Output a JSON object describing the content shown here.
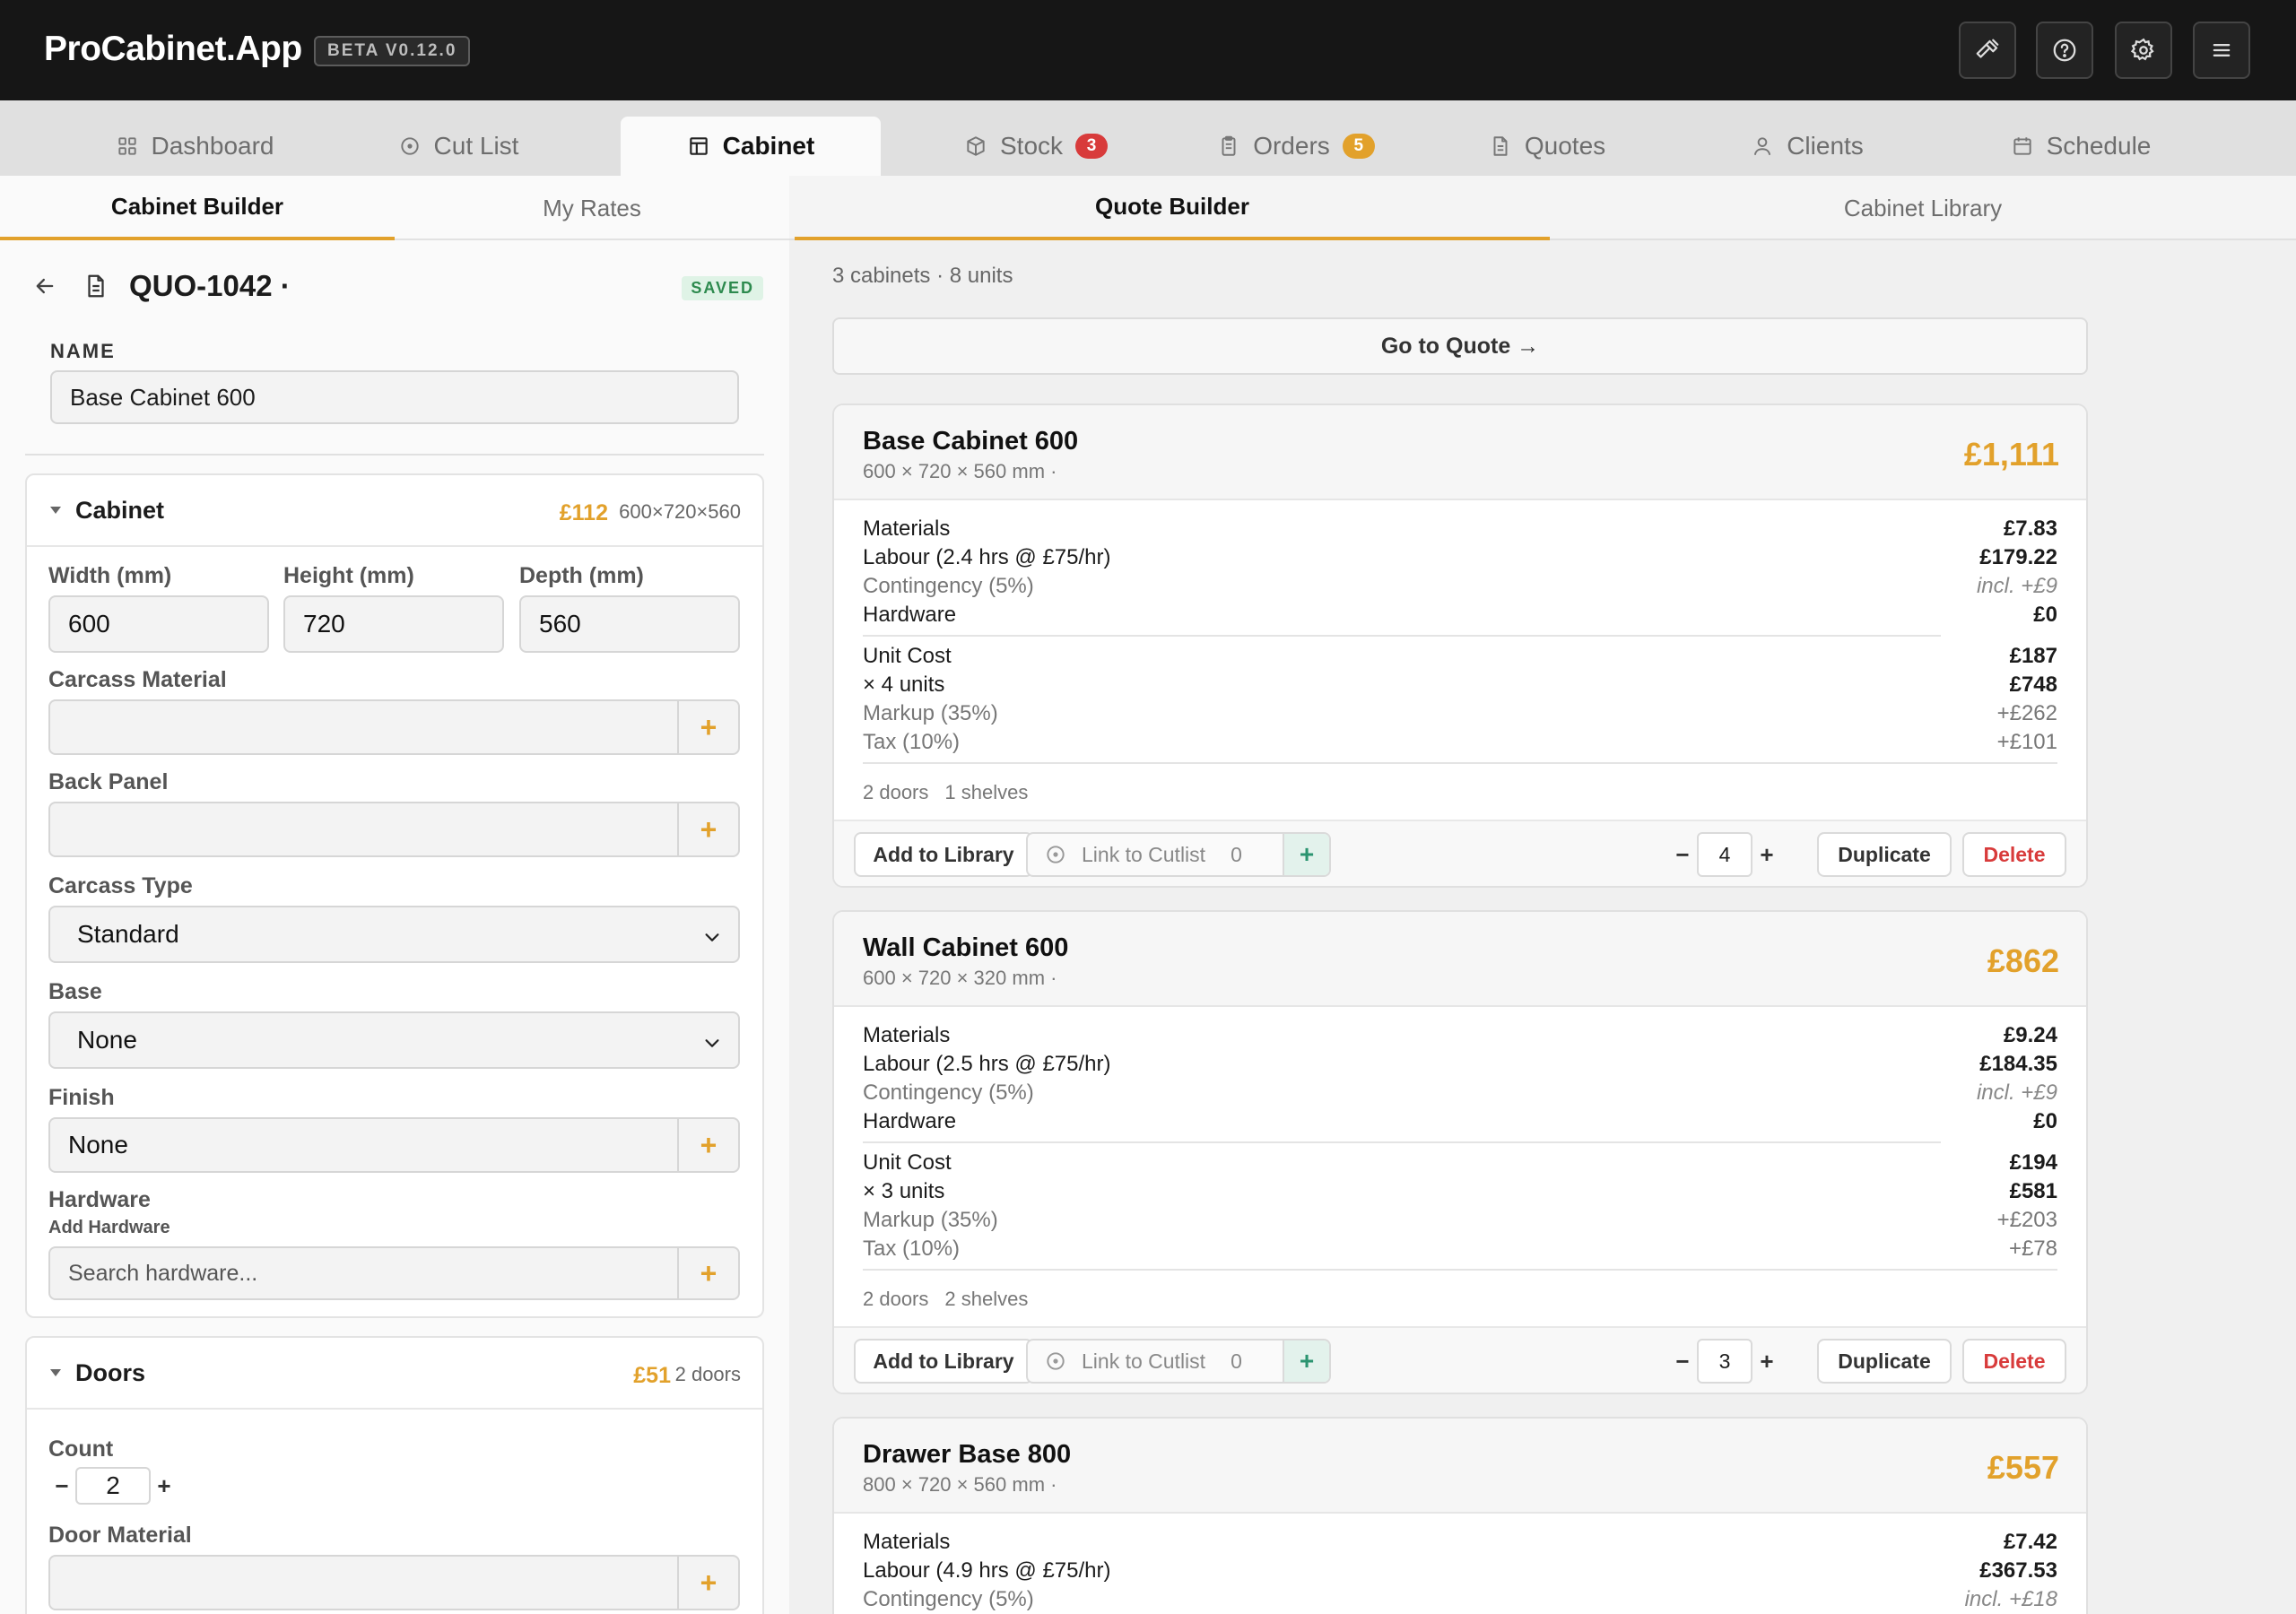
{
  "app": {
    "brand": "ProCabinet.App",
    "version": "BETA V0.12.0"
  },
  "toolbar_icons": [
    "hammer-icon",
    "help-icon",
    "settings-icon",
    "menu-icon"
  ],
  "main_tabs": [
    {
      "label": "Dashboard",
      "icon": "dashboard-icon"
    },
    {
      "label": "Cut List",
      "icon": "target-icon"
    },
    {
      "label": "Cabinet",
      "icon": "cabinet-icon",
      "active": true
    },
    {
      "label": "Stock",
      "icon": "box-icon",
      "badge": "3"
    },
    {
      "label": "Orders",
      "icon": "clipboard-icon",
      "badge": "5"
    },
    {
      "label": "Quotes",
      "icon": "document-icon"
    },
    {
      "label": "Clients",
      "icon": "user-icon"
    },
    {
      "label": "Schedule",
      "icon": "calendar-icon"
    }
  ],
  "left_tabs": {
    "builder": "Cabinet Builder",
    "rates": "My Rates"
  },
  "quote": {
    "number": "QUO-1042 ·",
    "status": "SAVED"
  },
  "name_field": {
    "label": "NAME",
    "value": "Base Cabinet 600"
  },
  "cabinet_section": {
    "title": "Cabinet",
    "price": "£112",
    "dims": "600×720×560",
    "width_label": "Width (mm)",
    "width": "600",
    "height_label": "Height (mm)",
    "height": "720",
    "depth_label": "Depth (mm)",
    "depth": "560",
    "carcass_material_label": "Carcass Material",
    "carcass_material": "",
    "back_panel_label": "Back Panel",
    "back_panel": "",
    "carcass_type_label": "Carcass Type",
    "carcass_type": "Standard",
    "base_label": "Base",
    "base": "None",
    "finish_label": "Finish",
    "finish": "None",
    "hardware_label": "Hardware",
    "add_hardware_label": "Add Hardware",
    "hardware_placeholder": "Search hardware..."
  },
  "doors_section": {
    "title": "Doors",
    "price": "£51",
    "summary": "2 doors",
    "count_label": "Count",
    "count": "2",
    "door_material_label": "Door Material",
    "door_material": ""
  },
  "right_tabs": {
    "quote_builder": "Quote Builder",
    "library": "Cabinet Library"
  },
  "summary": "3 cabinets · 8 units",
  "go_to_quote": "Go to Quote →",
  "footer_labels": {
    "add_library": "Add to Library",
    "link_cutlist": "Link to Cutlist",
    "link_count": "0",
    "duplicate": "Duplicate",
    "delete": "Delete"
  },
  "cabinets": [
    {
      "title": "Base Cabinet 600",
      "dims": "600 × 720 × 560 mm ·",
      "price": "£1,111",
      "materials": "£7.83",
      "labour_label": "Labour (2.4 hrs @ £75/hr)",
      "labour": "£179.22",
      "contingency_label": "Contingency (5%)",
      "contingency": "incl. +£9",
      "hardware": "£0",
      "unit_cost": "£187",
      "units_label": "× 4 units",
      "units_total": "£748",
      "markup_label": "Markup (35%)",
      "markup": "+£262",
      "tax_label": "Tax (10%)",
      "tax": "+£101",
      "doors": "2 doors",
      "shelves": "1 shelves",
      "qty": "4"
    },
    {
      "title": "Wall Cabinet 600",
      "dims": "600 × 720 × 320 mm ·",
      "price": "£862",
      "materials": "£9.24",
      "labour_label": "Labour (2.5 hrs @ £75/hr)",
      "labour": "£184.35",
      "contingency_label": "Contingency (5%)",
      "contingency": "incl. +£9",
      "hardware": "£0",
      "unit_cost": "£194",
      "units_label": "× 3 units",
      "units_total": "£581",
      "markup_label": "Markup (35%)",
      "markup": "+£203",
      "tax_label": "Tax (10%)",
      "tax": "+£78",
      "doors": "2 doors",
      "shelves": "2 shelves",
      "qty": "3"
    },
    {
      "title": "Drawer Base 800",
      "dims": "800 × 720 × 560 mm ·",
      "price": "£557",
      "materials": "£7.42",
      "labour_label": "Labour (4.9 hrs @ £75/hr)",
      "labour": "£367.53",
      "contingency_label": "Contingency (5%)",
      "contingency": "incl. +£18"
    }
  ],
  "row_labels": {
    "materials": "Materials",
    "hardware": "Hardware",
    "unit_cost": "Unit Cost"
  },
  "colors": {
    "accent": "#e2a12b",
    "danger": "#d83b3b",
    "success": "#2b9470",
    "topbar": "#161616"
  }
}
